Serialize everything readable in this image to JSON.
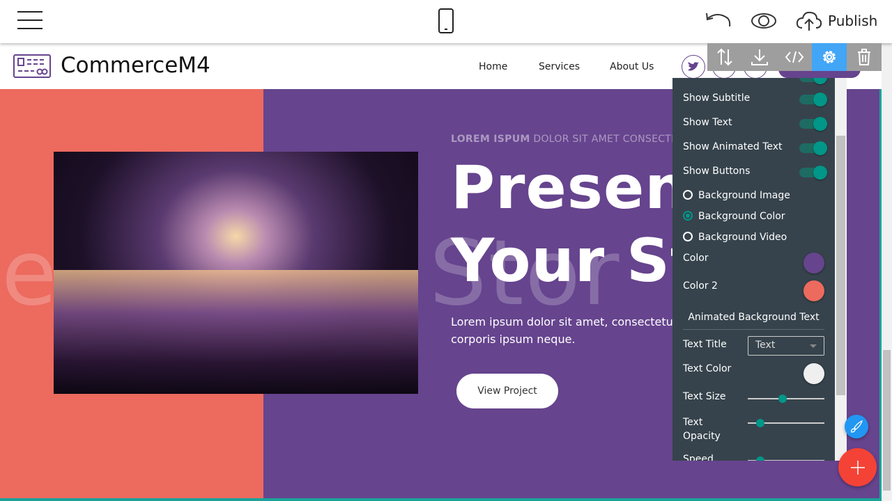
{
  "topbar": {
    "publish_label": "Publish",
    "icons": [
      "menu-icon",
      "mobile-icon",
      "undo-icon",
      "eye-icon",
      "cloud-upload-icon"
    ]
  },
  "navbar": {
    "brand": "CommerceM4",
    "links": [
      "Home",
      "Services",
      "About Us"
    ],
    "social": [
      "twitter",
      "facebook",
      "instagram"
    ],
    "brand_color": "#66448e"
  },
  "hero": {
    "subtitle_bold": "LOREM ISPUM",
    "subtitle_rest": " DOLOR SIT AMET CONSECTE",
    "title_line1": "Presen",
    "title_line2": "Your St",
    "paragraph": "Lorem ipsum dolor sit amet, consectetur corporis ipsum neque.",
    "button": "View Project",
    "animated_text": "e          r Stor",
    "colors": {
      "background": "#66448e",
      "left": "#ec6a5e"
    }
  },
  "toolbar": {
    "icons": [
      "sort-icon",
      "download-icon",
      "code-icon",
      "gear-icon",
      "trash-icon"
    ],
    "active": "gear-icon"
  },
  "panel": {
    "toggles": [
      {
        "label": "Show Subtitle",
        "on": true
      },
      {
        "label": "Show Text",
        "on": true
      },
      {
        "label": "Show Animated Text",
        "on": true
      },
      {
        "label": "Show Buttons",
        "on": true
      }
    ],
    "radios": [
      {
        "label": "Background Image",
        "selected": false
      },
      {
        "label": "Background Color",
        "selected": true
      },
      {
        "label": "Background Video",
        "selected": false
      }
    ],
    "color_label": "Color",
    "color": "#66448e",
    "color2_label": "Color 2",
    "color2": "#ec6a5e",
    "section_title": "Animated Background Text",
    "text_title_label": "Text Title",
    "text_title_value": "Text",
    "text_color_label": "Text Color",
    "text_color": "#efefef",
    "text_size_label": "Text Size",
    "text_size_value": 0.45,
    "text_opacity_label": "Text Opacity",
    "text_opacity_value": 0.16,
    "speed_label": "Speed",
    "speed_value": 0.16
  }
}
